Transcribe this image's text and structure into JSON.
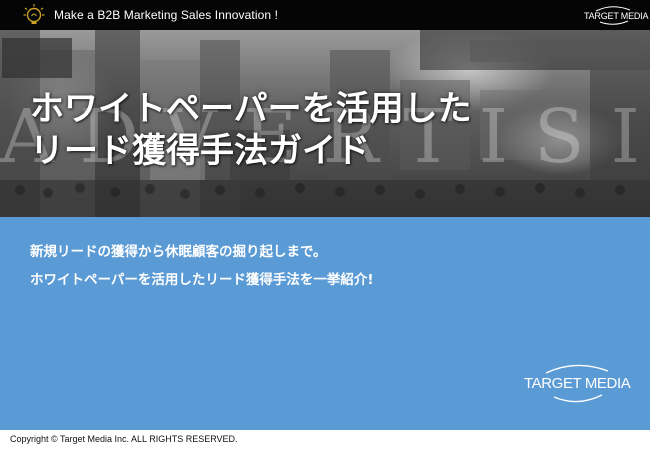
{
  "header": {
    "tagline": "Make a B2B Marketing Sales Innovation !",
    "brand": "TARGET MEDIA"
  },
  "hero": {
    "title_lines": [
      "ホワイトペーパーを活用した",
      "リード獲得手法ガイド"
    ],
    "watermark": "ADVERTISING"
  },
  "panel": {
    "lead_lines": [
      "新規リードの獲得から休眠顧客の掘り起しまで。",
      "ホワイトペーパーを活用したリード獲得手法を一挙紹介!"
    ],
    "brand": "TARGET MEDIA"
  },
  "footer": {
    "copyright": "Copyright © Target Media Inc. ALL RIGHTS RESERVED."
  },
  "colors": {
    "topbar": "#050505",
    "panel_blue": "#5a9ad5",
    "text_light": "#ffffff"
  },
  "icons": {
    "header_left": "lightbulb-icon",
    "brand_mark": "arc-swoosh-icon"
  }
}
